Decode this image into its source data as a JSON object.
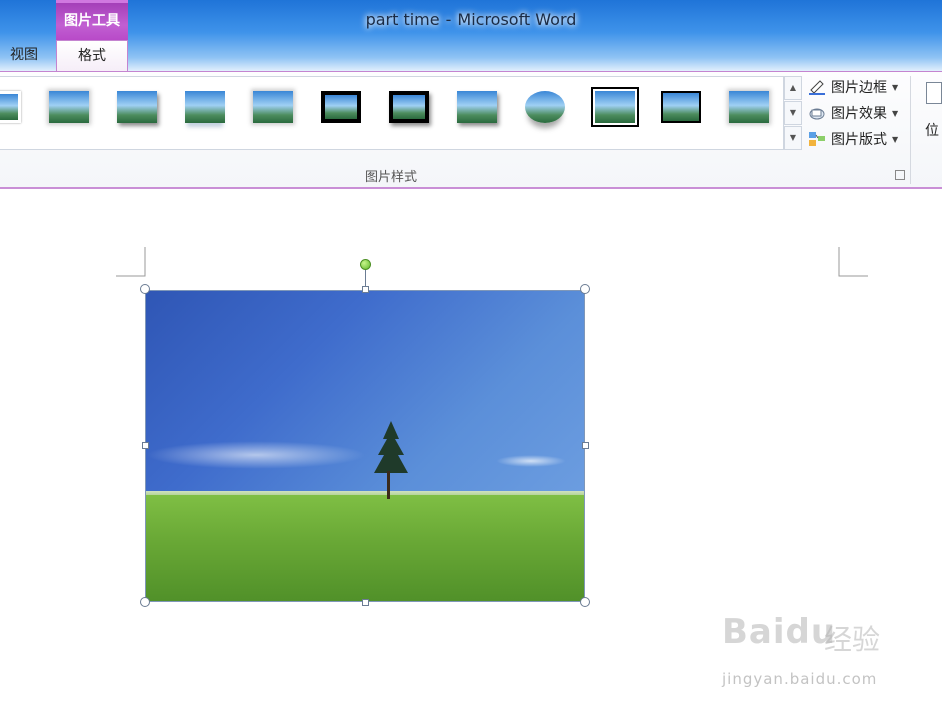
{
  "window": {
    "doc_name": "part time",
    "separator": "-",
    "app_name": "Microsoft Word"
  },
  "ribbon": {
    "contextual_group": "图片工具",
    "tabs": {
      "view": "视图",
      "format": "格式"
    },
    "picture_styles": {
      "group_label": "图片样式",
      "commands": {
        "border": "图片边框",
        "effects": "图片效果",
        "layout": "图片版式"
      }
    },
    "arrange": {
      "position_label": "位"
    }
  },
  "watermark": {
    "logo": "Baidu",
    "cn": "经验",
    "url": "jingyan.baidu.com"
  },
  "colors": {
    "title_bar": "#3f93ea",
    "contextual_tab": "#b84ac8",
    "rotate_handle": "#5fb82a"
  }
}
